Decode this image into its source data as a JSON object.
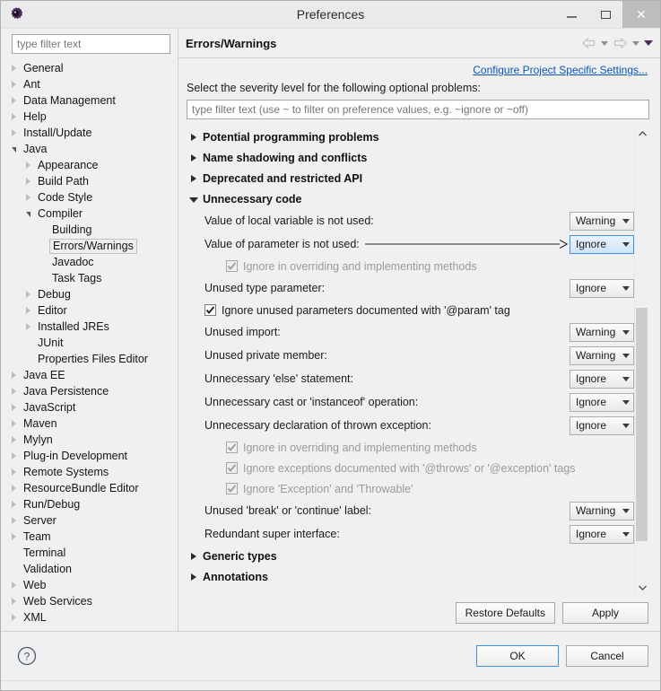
{
  "window": {
    "title": "Preferences",
    "icon": "preferences-gear-icon",
    "controls": {
      "minimize": "minimize-icon",
      "maximize": "maximize-icon",
      "close": "close-icon"
    }
  },
  "sidebar": {
    "filter_placeholder": "type filter text",
    "filter_value": "",
    "items": [
      {
        "label": "General",
        "indent": 0,
        "state": "collapsed"
      },
      {
        "label": "Ant",
        "indent": 0,
        "state": "collapsed"
      },
      {
        "label": "Data Management",
        "indent": 0,
        "state": "collapsed"
      },
      {
        "label": "Help",
        "indent": 0,
        "state": "collapsed"
      },
      {
        "label": "Install/Update",
        "indent": 0,
        "state": "collapsed"
      },
      {
        "label": "Java",
        "indent": 0,
        "state": "expanded"
      },
      {
        "label": "Appearance",
        "indent": 1,
        "state": "collapsed"
      },
      {
        "label": "Build Path",
        "indent": 1,
        "state": "collapsed"
      },
      {
        "label": "Code Style",
        "indent": 1,
        "state": "collapsed"
      },
      {
        "label": "Compiler",
        "indent": 1,
        "state": "expanded"
      },
      {
        "label": "Building",
        "indent": 2,
        "state": "leaf"
      },
      {
        "label": "Errors/Warnings",
        "indent": 2,
        "state": "leaf",
        "selected": true
      },
      {
        "label": "Javadoc",
        "indent": 2,
        "state": "leaf"
      },
      {
        "label": "Task Tags",
        "indent": 2,
        "state": "leaf"
      },
      {
        "label": "Debug",
        "indent": 1,
        "state": "collapsed"
      },
      {
        "label": "Editor",
        "indent": 1,
        "state": "collapsed"
      },
      {
        "label": "Installed JREs",
        "indent": 1,
        "state": "collapsed"
      },
      {
        "label": "JUnit",
        "indent": 1,
        "state": "leaf"
      },
      {
        "label": "Properties Files Editor",
        "indent": 1,
        "state": "leaf"
      },
      {
        "label": "Java EE",
        "indent": 0,
        "state": "collapsed"
      },
      {
        "label": "Java Persistence",
        "indent": 0,
        "state": "collapsed"
      },
      {
        "label": "JavaScript",
        "indent": 0,
        "state": "collapsed"
      },
      {
        "label": "Maven",
        "indent": 0,
        "state": "collapsed"
      },
      {
        "label": "Mylyn",
        "indent": 0,
        "state": "collapsed"
      },
      {
        "label": "Plug-in Development",
        "indent": 0,
        "state": "collapsed"
      },
      {
        "label": "Remote Systems",
        "indent": 0,
        "state": "collapsed"
      },
      {
        "label": "ResourceBundle Editor",
        "indent": 0,
        "state": "collapsed"
      },
      {
        "label": "Run/Debug",
        "indent": 0,
        "state": "collapsed"
      },
      {
        "label": "Server",
        "indent": 0,
        "state": "collapsed"
      },
      {
        "label": "Team",
        "indent": 0,
        "state": "collapsed"
      },
      {
        "label": "Terminal",
        "indent": 0,
        "state": "leaf"
      },
      {
        "label": "Validation",
        "indent": 0,
        "state": "leaf"
      },
      {
        "label": "Web",
        "indent": 0,
        "state": "collapsed"
      },
      {
        "label": "Web Services",
        "indent": 0,
        "state": "collapsed"
      },
      {
        "label": "XML",
        "indent": 0,
        "state": "collapsed"
      }
    ]
  },
  "page": {
    "title": "Errors/Warnings",
    "nav": {
      "back": "back-arrow-icon",
      "back_menu": "back-dropdown-icon",
      "forward": "forward-arrow-icon",
      "forward_menu": "forward-dropdown-icon",
      "view_menu": "view-menu-icon"
    },
    "project_link": "Configure Project Specific Settings...",
    "instruction": "Select the severity level for the following optional problems:",
    "filter_placeholder": "type filter text (use ~ to filter on preference values, e.g. ~ignore or ~off)",
    "filter_value": "",
    "groups": [
      {
        "label": "Potential programming problems",
        "expanded": false,
        "rows": []
      },
      {
        "label": "Name shadowing and conflicts",
        "expanded": false,
        "rows": []
      },
      {
        "label": "Deprecated and restricted API",
        "expanded": false,
        "rows": []
      },
      {
        "label": "Unnecessary code",
        "expanded": true,
        "rows": [
          {
            "kind": "option",
            "label": "Value of local variable is not used:",
            "value": "Warning",
            "focused": false
          },
          {
            "kind": "option",
            "label": "Value of parameter is not used:",
            "value": "Ignore",
            "focused": true,
            "annotated": true
          },
          {
            "kind": "check",
            "label": "Ignore in overriding and implementing methods",
            "checked": true,
            "enabled": false
          },
          {
            "kind": "option",
            "label": "Unused type parameter:",
            "value": "Ignore",
            "focused": false
          },
          {
            "kind": "check",
            "label": "Ignore unused parameters documented with '@param' tag",
            "checked": true,
            "enabled": true,
            "indent": 1
          },
          {
            "kind": "option",
            "label": "Unused import:",
            "value": "Warning",
            "focused": false
          },
          {
            "kind": "option",
            "label": "Unused private member:",
            "value": "Warning",
            "focused": false
          },
          {
            "kind": "option",
            "label": "Unnecessary 'else' statement:",
            "value": "Ignore",
            "focused": false
          },
          {
            "kind": "option",
            "label": "Unnecessary cast or 'instanceof' operation:",
            "value": "Ignore",
            "focused": false
          },
          {
            "kind": "option",
            "label": "Unnecessary declaration of thrown exception:",
            "value": "Ignore",
            "focused": false
          },
          {
            "kind": "check",
            "label": "Ignore in overriding and implementing methods",
            "checked": true,
            "enabled": false
          },
          {
            "kind": "check",
            "label": "Ignore exceptions documented with '@throws' or '@exception' tags",
            "checked": true,
            "enabled": false
          },
          {
            "kind": "check",
            "label": "Ignore 'Exception' and 'Throwable'",
            "checked": true,
            "enabled": false
          },
          {
            "kind": "option",
            "label": "Unused 'break' or 'continue' label:",
            "value": "Warning",
            "focused": false
          },
          {
            "kind": "option",
            "label": "Redundant super interface:",
            "value": "Ignore",
            "focused": false
          }
        ]
      },
      {
        "label": "Generic types",
        "expanded": false,
        "rows": []
      },
      {
        "label": "Annotations",
        "expanded": false,
        "rows": []
      }
    ],
    "scrollbar": {
      "up": "scroll-up-icon",
      "down": "scroll-down-icon"
    },
    "buttons": {
      "restore_defaults": "Restore Defaults",
      "apply": "Apply"
    }
  },
  "footer": {
    "help": "help-icon",
    "ok": "OK",
    "cancel": "Cancel"
  },
  "colors": {
    "accent_blue": "#3c94e0",
    "link_blue": "#0b54b7",
    "window_bg": "#f0f0f0",
    "gear_purple": "#4a2a5e"
  }
}
